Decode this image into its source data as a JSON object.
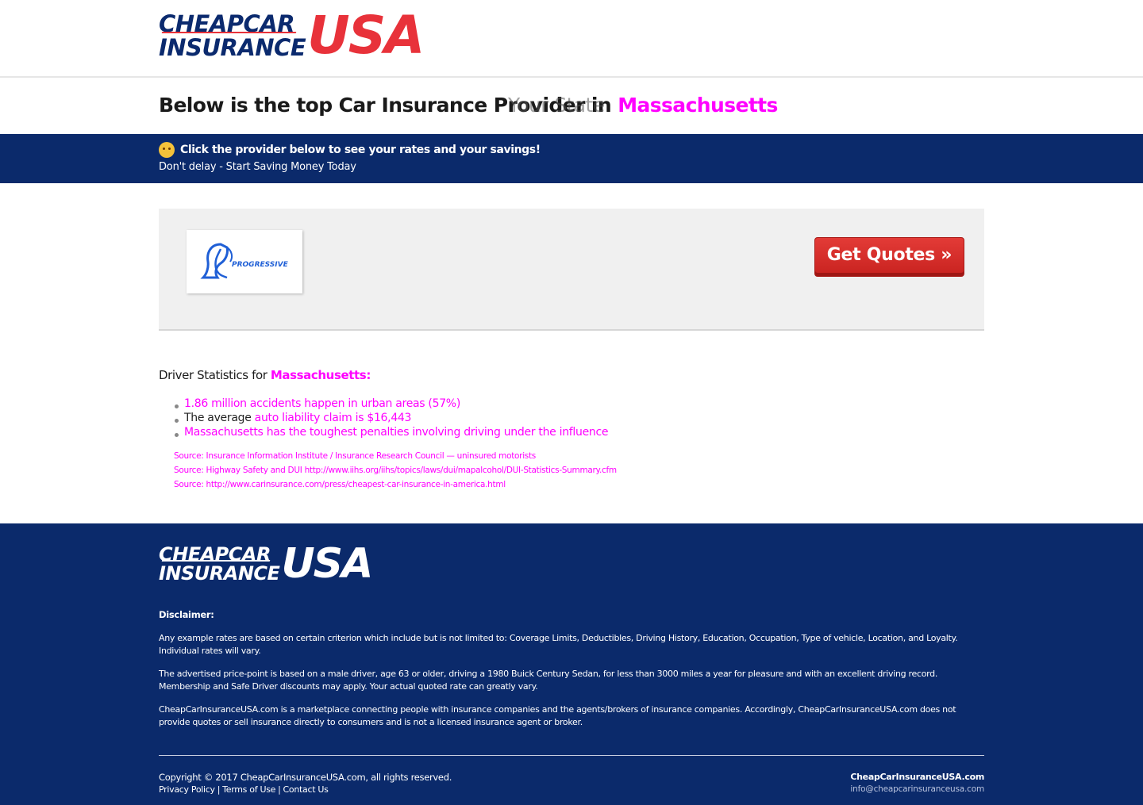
{
  "header": {
    "logo_line1": "CHEAPCAR",
    "logo_line2": "INSURANCE",
    "logo_usa": "USA"
  },
  "title": {
    "prefix": "Below is the top Car Insurance Provider in",
    "state": "Massachusetts",
    "ghost": "Your State"
  },
  "banner": {
    "headline": "Click the provider below to see your rates and your savings!",
    "subline": "Don't delay - Start Saving Money Today"
  },
  "provider": {
    "name": "PROGRESSIVE",
    "cta": "Get Quotes »"
  },
  "stats": {
    "heading_prefix": "Driver Statistics for",
    "heading_state": "Massachusetts:",
    "items": [
      {
        "prefix": "",
        "text": "1.86 million accidents happen in urban areas (57%)"
      },
      {
        "prefix": "The average",
        "text": "auto liability claim is $16,443"
      },
      {
        "prefix": "",
        "text": "Massachusetts has the toughest penalties involving driving under the influence"
      }
    ],
    "sources": [
      "Source: Insurance Information Institute / Insurance Research Council — uninsured motorists",
      "Source: Highway Safety and DUI http://www.iihs.org/iihs/topics/laws/dui/mapalcohol/DUI-Statistics-Summary.cfm",
      "Source: http://www.carinsurance.com/press/cheapest-car-insurance-in-america.html"
    ]
  },
  "footer": {
    "disclaimer_label": "Disclaimer:",
    "paragraphs": [
      "Any example rates are based on certain criterion which include but is not limited to: Coverage Limits, Deductibles, Driving History, Education, Occupation, Type of vehicle, Location, and Loyalty. Individual rates will vary.",
      "The advertised price-point is based on a male driver, age 63 or older, driving a 1980 Buick Century Sedan, for less than 3000 miles a year for pleasure and with an excellent driving record. Membership and Safe Driver discounts may apply. Your actual quoted rate can greatly vary.",
      "CheapCarInsuranceUSA.com is a marketplace connecting people with insurance companies and the agents/brokers of insurance companies. Accordingly, CheapCarInsuranceUSA.com does not provide quotes or sell insurance directly to consumers and is not a licensed insurance agent or broker."
    ],
    "copyright": "Copyright © 2017 CheapCarInsuranceUSA.com, all rights reserved.",
    "links": [
      "Privacy Policy",
      "Terms of Use",
      "Contact Us"
    ],
    "site_name": "CheapCarInsuranceUSA.com",
    "email": "info@cheapcarinsuranceusa.com"
  },
  "colors": {
    "navy": "#0b2a6b",
    "brand_red": "#e8323a",
    "button_red": "#d02b28",
    "placeholder_magenta": "#ff00ff"
  }
}
